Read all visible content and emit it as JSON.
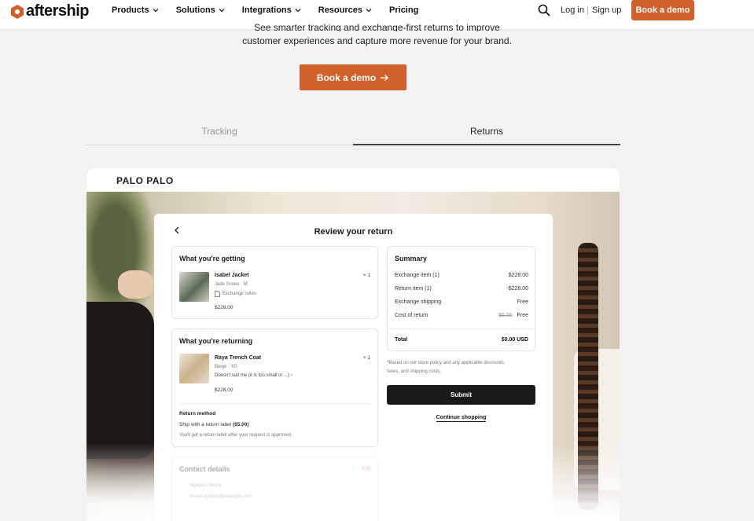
{
  "nav": {
    "logo_text": "aftership",
    "menu": [
      {
        "label": "Products",
        "dropdown": true
      },
      {
        "label": "Solutions",
        "dropdown": true
      },
      {
        "label": "Integrations",
        "dropdown": true
      },
      {
        "label": "Resources",
        "dropdown": true
      },
      {
        "label": "Pricing",
        "dropdown": false
      }
    ],
    "login": "Log in",
    "separator": "|",
    "signup": "Sign up",
    "cta": "Book a demo",
    "accent": "#d2602a"
  },
  "hero": {
    "line1": "See smarter tracking and exchange-first returns to improve",
    "line2": "customer experiences and capture more revenue for your brand.",
    "cta": "Book a demo",
    "cta_icon": "arrow-right-icon"
  },
  "tabs": [
    {
      "label": "Tracking",
      "active": false
    },
    {
      "label": "Returns",
      "active": true
    }
  ],
  "demo": {
    "brand": "PALO PALO",
    "back_icon": "chevron-left-icon",
    "title": "Review your return",
    "getting": {
      "heading": "What you're getting",
      "item_name": "Isabel Jacket",
      "item_variant": "Jade Green · M",
      "notes": "Exchange notes",
      "price": "$228.00",
      "qty": "× 1"
    },
    "returning": {
      "heading": "What you're returning",
      "item_name": "Raya Trench Coat",
      "item_variant": "Beige · XS",
      "reason": "Doesn't suit me (it is too small or ...)",
      "price": "$228.00",
      "qty": "× 1",
      "method_label": "Return method",
      "method_text": "Ship with a return label",
      "method_price": "($5.00)",
      "method_note": "You'll get a return label after your request is approved."
    },
    "contact": {
      "heading": "Contact details",
      "edit": "Edit",
      "name": "Nguyen, Shane",
      "email": "shane.nguyen@example.com"
    },
    "summary": {
      "heading": "Summary",
      "rows": [
        {
          "label": "Exchange item (1)",
          "value": "$228.00"
        },
        {
          "label": "Return item (1)",
          "value": "-$228.00"
        },
        {
          "label": "Exchange shipping",
          "value": "Free"
        },
        {
          "label": "Cost of return",
          "old_value": "$5.00",
          "value": "Free"
        }
      ],
      "total_label": "Total",
      "total_value": "$0.00 USD"
    },
    "policy_note_1": "*Based on our store policy and any applicable discounts,",
    "policy_note_2": "taxes, and shipping costs.",
    "submit": "Submit",
    "continue": "Continue shopping"
  }
}
